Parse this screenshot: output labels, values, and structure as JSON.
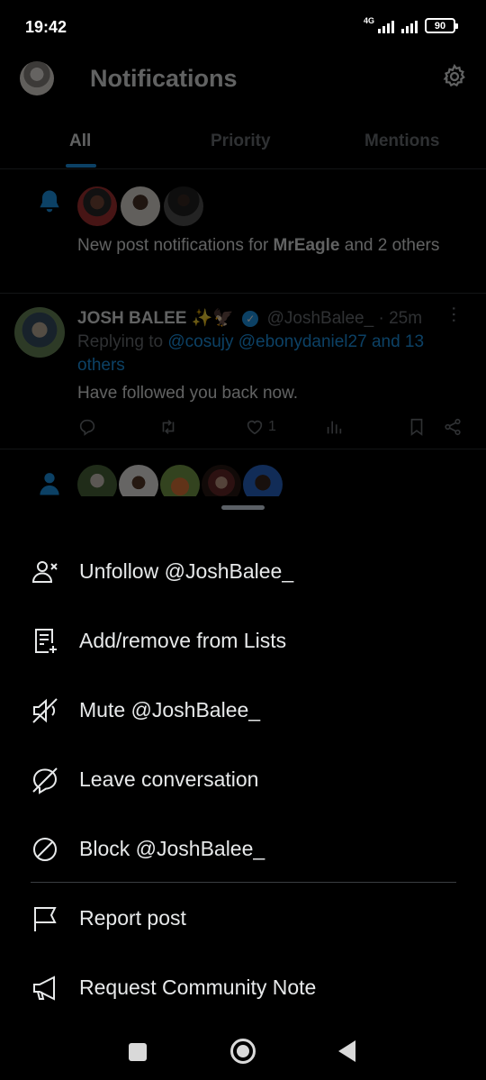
{
  "status_bar": {
    "time": "19:42",
    "network": "4G",
    "battery": "90"
  },
  "header": {
    "title": "Notifications"
  },
  "tabs": [
    {
      "label": "All",
      "active": true
    },
    {
      "label": "Priority",
      "active": false
    },
    {
      "label": "Mentions",
      "active": false
    }
  ],
  "notification_1": {
    "text_prefix": "New post notifications for ",
    "bold_name": "MrEagle",
    "text_suffix": " and 2 others"
  },
  "tweet": {
    "name": "JOSH BALEE",
    "emoji": "✨🦅",
    "handle": "@JoshBalee_",
    "time": "· 25m",
    "replying_prefix": "Replying to",
    "mentions": "@cosujy @ebonydaniel27 and 13 others",
    "body": "Have followed you back now.",
    "likes": "1"
  },
  "sheet": {
    "items": [
      {
        "icon": "unfollow-icon",
        "label": "Unfollow @JoshBalee_"
      },
      {
        "icon": "lists-icon",
        "label": "Add/remove from Lists"
      },
      {
        "icon": "mute-icon",
        "label": "Mute @JoshBalee_"
      },
      {
        "icon": "leave-conversation-icon",
        "label": "Leave conversation"
      },
      {
        "icon": "block-icon",
        "label": "Block @JoshBalee_"
      },
      {
        "icon": "flag-icon",
        "label": "Report post"
      },
      {
        "icon": "megaphone-icon",
        "label": "Request Community Note"
      }
    ]
  },
  "colors": {
    "accent": "#1d9bf0",
    "background": "#000000",
    "muted": "#71767b"
  }
}
